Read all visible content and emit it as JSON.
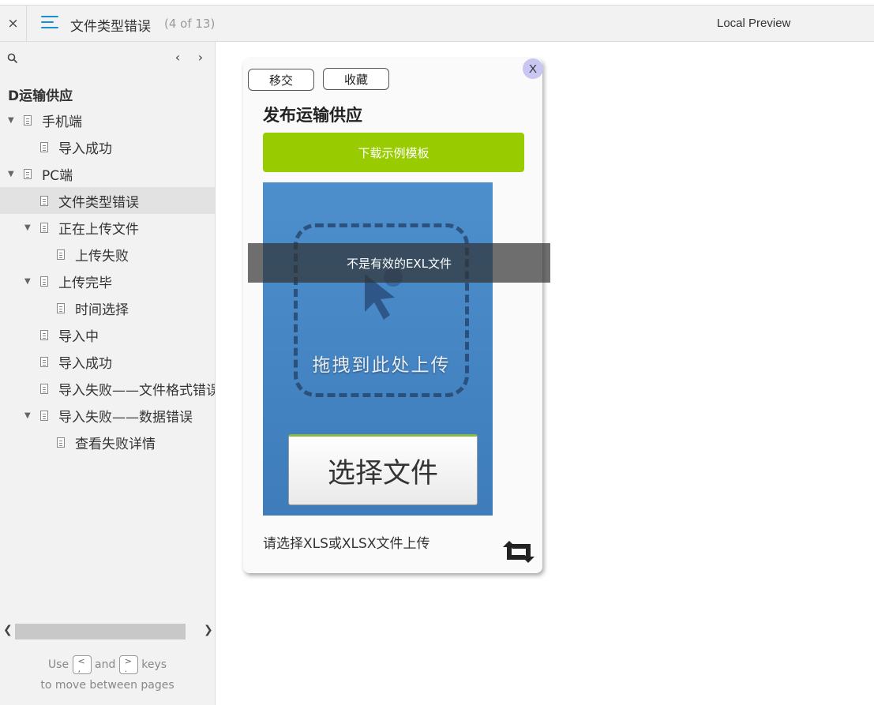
{
  "topbar": {
    "close_label": "×",
    "title": "文件类型错误",
    "page_count": "(4 of 13)",
    "local_preview": "Local Preview"
  },
  "sidebar": {
    "prev_label": "‹",
    "next_label": "›",
    "root": "D运输供应",
    "items": [
      {
        "label": "手机端",
        "level": 0,
        "expanded": true
      },
      {
        "label": "导入成功",
        "level": 1
      },
      {
        "label": "PC端",
        "level": 0,
        "expanded": true
      },
      {
        "label": "文件类型错误",
        "level": 1,
        "active": true
      },
      {
        "label": "正在上传文件",
        "level": 1,
        "expanded": true
      },
      {
        "label": "上传失败",
        "level": 2
      },
      {
        "label": "上传完毕",
        "level": 1,
        "expanded": true
      },
      {
        "label": "时间选择",
        "level": 2
      },
      {
        "label": "导入中",
        "level": 1
      },
      {
        "label": "导入成功",
        "level": 1
      },
      {
        "label": "导入失败——文件格式错误",
        "level": 1
      },
      {
        "label": "导入失败——数据错误",
        "level": 1,
        "expanded": true
      },
      {
        "label": "查看失败详情",
        "level": 2
      }
    ],
    "hint_use": "Use",
    "hint_and": "and",
    "hint_keys": "keys",
    "hint_line2": "to move between pages",
    "key_prev": "<\n,",
    "key_next": ">\n."
  },
  "card": {
    "transfer_label": "移交",
    "collect_label": "收藏",
    "close_label": "X",
    "title": "发布运输供应",
    "download_label": "下载示例模板",
    "drag_text": "拖拽到此处上传",
    "choose_label": "选择文件",
    "instructions": "请选择XLS或XLSX文件上传"
  },
  "toast": {
    "message": "不是有效的EXL文件"
  },
  "colors": {
    "accent_green": "#99cc00",
    "upload_blue": "#4d8fcc",
    "menu_blue": "#1a8fd0"
  }
}
